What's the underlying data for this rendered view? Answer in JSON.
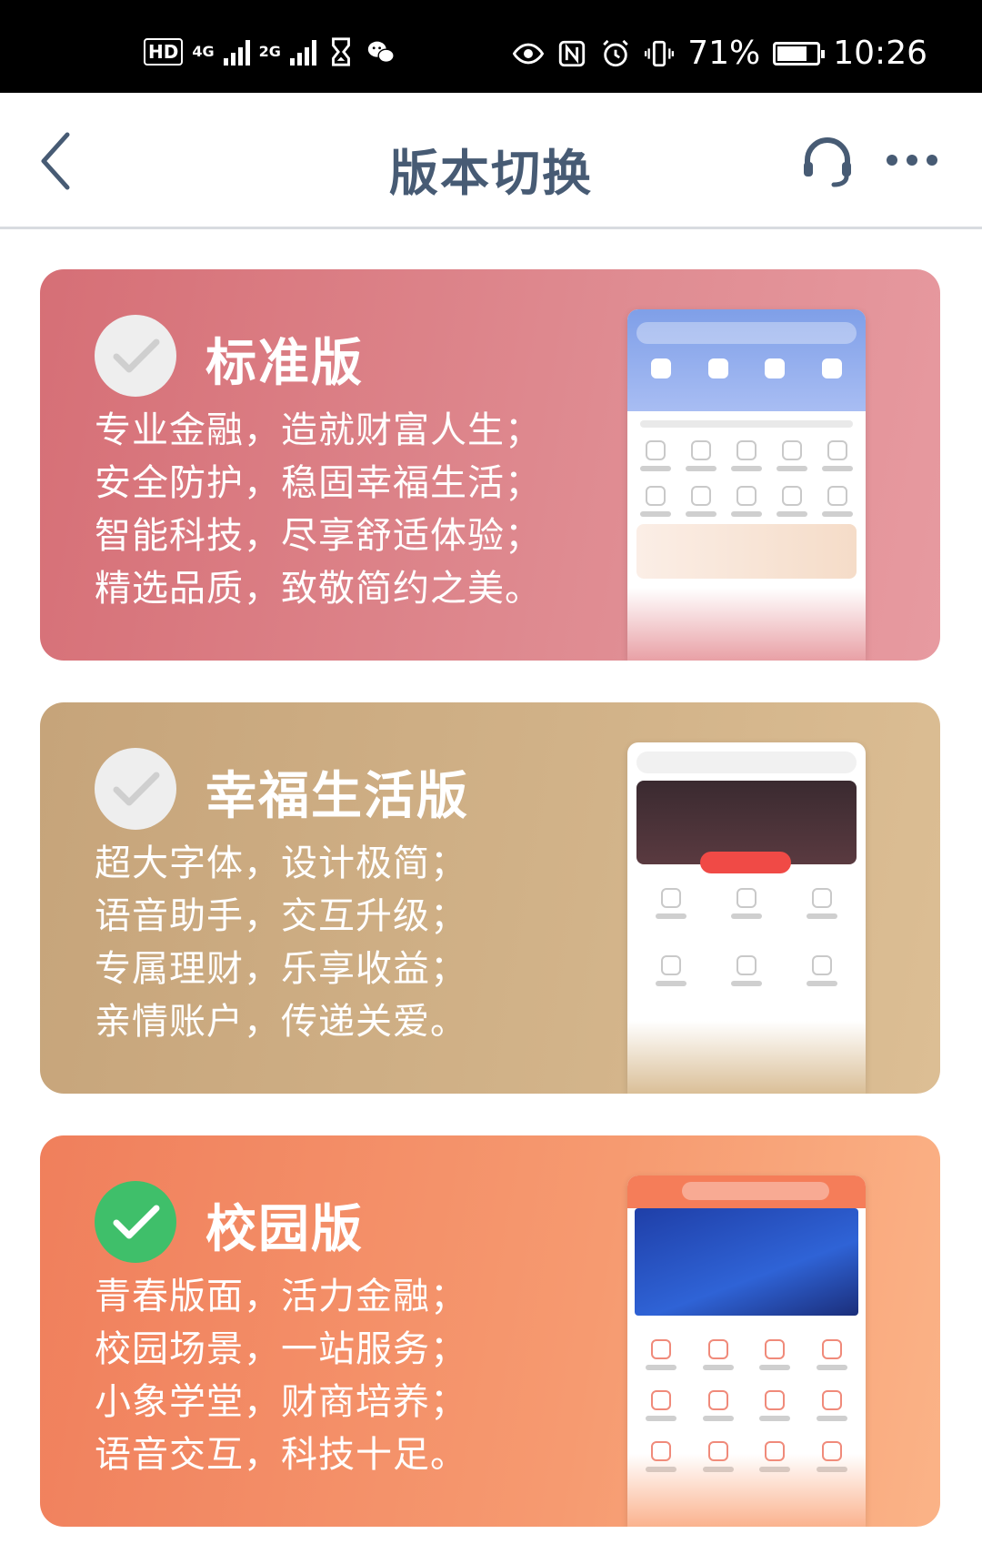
{
  "status_bar": {
    "hd": "HD",
    "sim1": "4G",
    "sim2": "2G",
    "battery": "71%",
    "time": "10:26"
  },
  "nav": {
    "title": "版本切换"
  },
  "cards": [
    {
      "title": "标准版",
      "selected": false,
      "lines": [
        "专业金融，造就财富人生；",
        "安全防护，稳固幸福生活；",
        "智能科技，尽享舒适体验；",
        "精选品质，致敬简约之美。"
      ]
    },
    {
      "title": "幸福生活版",
      "selected": false,
      "lines": [
        "超大字体，设计极简；",
        "语音助手，交互升级；",
        "专属理财，乐享收益；",
        "亲情账户，传递关爱。"
      ]
    },
    {
      "title": "校园版",
      "selected": true,
      "lines": [
        "青春版面，活力金融；",
        "校园场景，一站服务；",
        "小象学堂，财商培养；",
        "语音交互，科技十足。"
      ]
    }
  ],
  "colors": {
    "nav_text": "#475b74",
    "check_on": "#3fbf6a",
    "card_standard": "#d66f76",
    "card_happy": "#c6a47a",
    "card_campus": "#f07f5c"
  },
  "icons": {
    "back": "chevron-left-icon",
    "support": "headset-icon",
    "more": "more-icon",
    "check": "check-icon"
  }
}
